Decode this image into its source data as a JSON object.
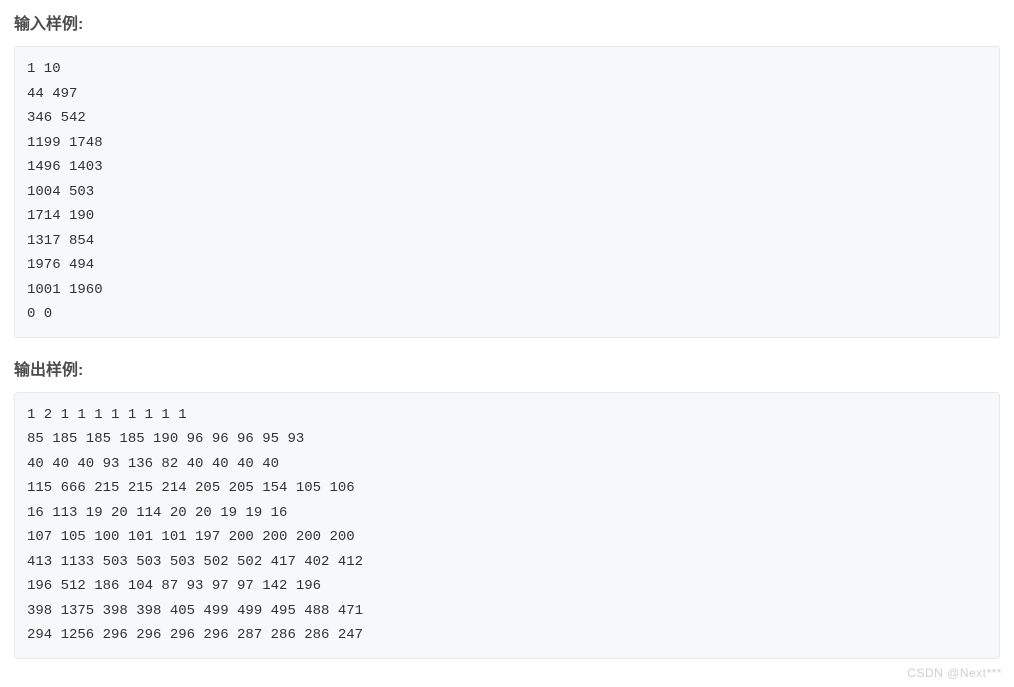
{
  "headings": {
    "input_example": "输入样例:",
    "output_example": "输出样例:"
  },
  "input_block": "1 10\n44 497\n346 542\n1199 1748\n1496 1403\n1004 503\n1714 190\n1317 854\n1976 494\n1001 1960\n0 0",
  "output_block": "1 2 1 1 1 1 1 1 1 1\n85 185 185 185 190 96 96 96 95 93\n40 40 40 93 136 82 40 40 40 40\n115 666 215 215 214 205 205 154 105 106\n16 113 19 20 114 20 20 19 19 16\n107 105 100 101 101 197 200 200 200 200\n413 1133 503 503 503 502 502 417 402 412\n196 512 186 104 87 93 97 97 142 196\n398 1375 398 398 405 499 499 495 488 471\n294 1256 296 296 296 296 287 286 286 247",
  "watermark": "CSDN @Next***"
}
